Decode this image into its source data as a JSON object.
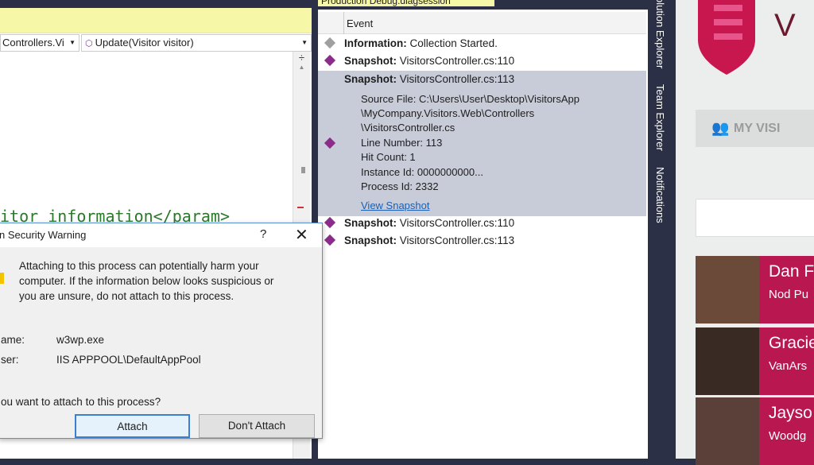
{
  "editor": {
    "class_dropdown": "Controllers.Vi",
    "method_dropdown": "Update(Visitor visitor)",
    "code_line": "itor information</param>"
  },
  "diag_tab": {
    "title": "Production Debug.diagsession"
  },
  "events": {
    "header": "Event",
    "rows": [
      {
        "kind": "Information:",
        "text": "Collection Started.",
        "color": "#a0a0a0"
      },
      {
        "kind": "Snapshot:",
        "text": "VisitorsController.cs:110",
        "color": "#8b2c8a"
      }
    ],
    "expanded": {
      "kind": "Snapshot:",
      "text": "VisitorsController.cs:113",
      "details": [
        "Source File: C:\\Users\\User\\Desktop\\VisitorsApp",
        "\\MyCompany.Visitors.Web\\Controllers",
        "\\VisitorsController.cs",
        "Line Number: 113",
        "Hit Count: 1",
        "Instance Id: 0000000000...",
        "Process Id: 2332"
      ],
      "link": "View Snapshot"
    },
    "after": [
      {
        "kind": "Snapshot:",
        "text": "VisitorsController.cs:110"
      },
      {
        "kind": "Snapshot:",
        "text": "VisitorsController.cs:113"
      }
    ]
  },
  "side_tabs": [
    "olution Explorer",
    "Team Explorer",
    "Notifications"
  ],
  "app": {
    "logo_text": "V",
    "my_visitors": "MY VISI",
    "accent": "#b8174f",
    "visitors": [
      {
        "name": "Dan F",
        "company": "Nod Pu"
      },
      {
        "name": "Gracie",
        "company": "VanArs"
      },
      {
        "name": "Jayso",
        "company": "Woodg"
      }
    ]
  },
  "dialog": {
    "title": "n Security Warning",
    "help": "?",
    "message": [
      "Attaching to this process can potentially harm your",
      "computer. If the information below looks suspicious or",
      "you are unsure, do not attach to this process."
    ],
    "name_label": "ame:",
    "name_value": "w3wp.exe",
    "user_label": "ser:",
    "user_value": "IIS APPPOOL\\DefaultAppPool",
    "question": "ou want to attach to this process?",
    "attach": "Attach",
    "dont_attach": "Don't Attach"
  }
}
